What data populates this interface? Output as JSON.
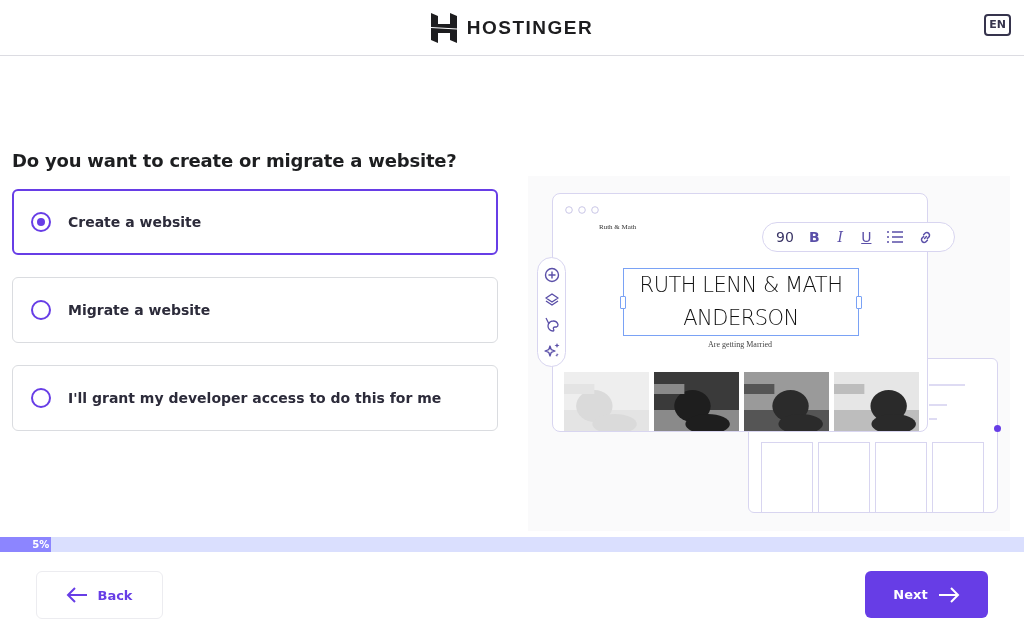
{
  "header": {
    "brand": "HOSTINGER",
    "language": "EN"
  },
  "question": "Do you want to create or migrate a website?",
  "options": [
    {
      "label": "Create a website",
      "selected": true
    },
    {
      "label": "Migrate a website",
      "selected": false
    },
    {
      "label": "I'll grant my developer access to do this for me",
      "selected": false
    }
  ],
  "illustration": {
    "site_name": "Ruth & Math",
    "headline": "RUTH LENN & MATH ANDERSON",
    "subtitle": "Are getting Married",
    "font_size": "90",
    "format_buttons": [
      "B",
      "I",
      "U"
    ],
    "photos": [
      {
        "kind": "picture"
      },
      {
        "kind": "picture"
      },
      {
        "kind": "picture"
      },
      {
        "kind": "picture"
      }
    ]
  },
  "progress": {
    "level": 0.05,
    "label": "5%"
  },
  "buttons": {
    "back": "Back",
    "next": "Next"
  }
}
